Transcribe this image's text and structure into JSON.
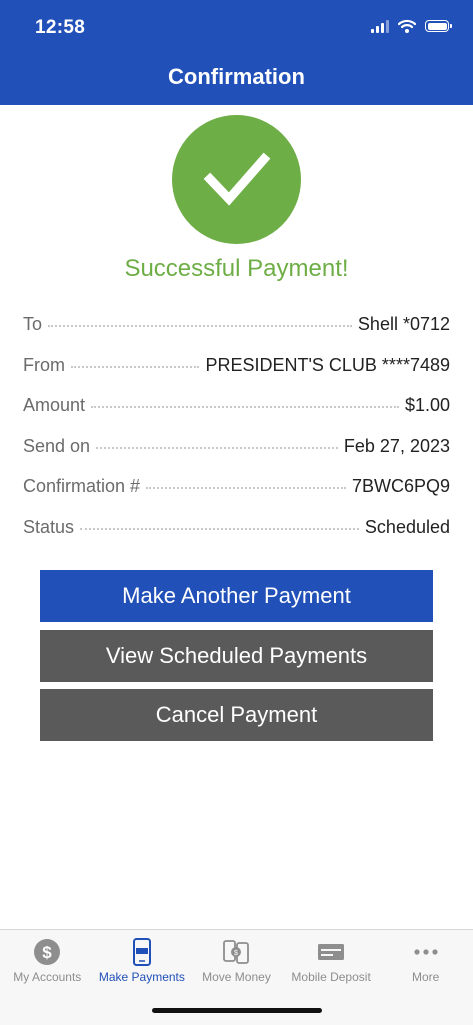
{
  "status_bar": {
    "time": "12:58"
  },
  "header": {
    "title": "Confirmation"
  },
  "message": "Successful Payment!",
  "details": [
    {
      "label": "To",
      "value": "Shell *0712"
    },
    {
      "label": "From",
      "value": "PRESIDENT'S CLUB ****7489"
    },
    {
      "label": "Amount",
      "value": "$1.00"
    },
    {
      "label": "Send on",
      "value": "Feb 27, 2023"
    },
    {
      "label": "Confirmation #",
      "value": "7BWC6PQ9"
    },
    {
      "label": "Status",
      "value": "Scheduled"
    }
  ],
  "buttons": {
    "make_another": "Make Another Payment",
    "view_scheduled": "View Scheduled Payments",
    "cancel": "Cancel Payment"
  },
  "tabs": [
    {
      "label": "My Accounts",
      "icon": "dollar-coin-icon"
    },
    {
      "label": "Make Payments",
      "icon": "pay-phone-icon",
      "active": true
    },
    {
      "label": "Move Money",
      "icon": "transfer-phones-icon"
    },
    {
      "label": "Mobile Deposit",
      "icon": "check-card-icon"
    },
    {
      "label": "More",
      "icon": "ellipsis-icon"
    }
  ],
  "colors": {
    "brand_blue": "#2150b8",
    "success_green": "#6eae46",
    "secondary_button": "#5a5a5a"
  }
}
